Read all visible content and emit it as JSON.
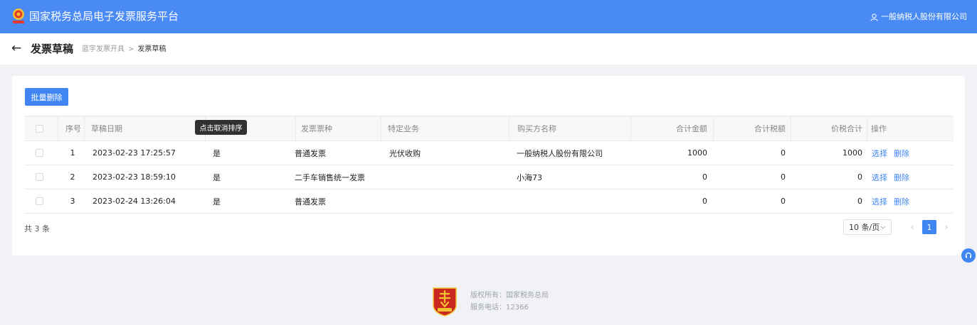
{
  "header": {
    "title": "国家税务总局电子发票服务平台",
    "user": "一般纳税人股份有限公司"
  },
  "subheader": {
    "title": "发票草稿",
    "breadcrumb_parent": "蓝字发票开具",
    "breadcrumb_sep": ">",
    "breadcrumb_current": "发票草稿"
  },
  "toolbar": {
    "batch_delete": "批量删除"
  },
  "table": {
    "columns": {
      "index": "序号",
      "draft_date": "草稿日期",
      "invoice_type": "发票票种",
      "special_business": "特定业务",
      "buyer_name": "购买方名称",
      "total_amount": "合计金额",
      "total_tax": "合计税额",
      "total_with_tax": "价税合计",
      "actions": "操作"
    },
    "rows": [
      {
        "index": "1",
        "draft_date": "2023-02-23 17:25:57",
        "flag": "是",
        "invoice_type": "普通发票",
        "special_business": "光伏收购",
        "buyer_name": "一般纳税人股份有限公司",
        "total_amount": "1000",
        "total_tax": "0",
        "total_with_tax": "1000",
        "select": "选择",
        "delete": "删除"
      },
      {
        "index": "2",
        "draft_date": "2023-02-23 18:59:10",
        "flag": "是",
        "invoice_type": "二手车销售统一发票",
        "special_business": "",
        "buyer_name": "小海73",
        "total_amount": "0",
        "total_tax": "0",
        "total_with_tax": "0",
        "select": "选择",
        "delete": "删除"
      },
      {
        "index": "3",
        "draft_date": "2023-02-24 13:26:04",
        "flag": "是",
        "invoice_type": "普通发票",
        "special_business": "",
        "buyer_name": "",
        "total_amount": "0",
        "total_tax": "0",
        "total_with_tax": "0",
        "select": "选择",
        "delete": "删除"
      }
    ],
    "tooltip": "点击取消排序"
  },
  "pagination": {
    "total": "共 3 条",
    "page_size": "10 条/页",
    "prev": "‹",
    "next": "›",
    "current_page": "1"
  },
  "footer": {
    "copyright": "版权所有：国家税务总局",
    "phone": "服务电话：12366"
  },
  "colors": {
    "primary": "#3f86f3",
    "header_bg": "#4a8af4",
    "page_bg": "#f0f2f5",
    "badge_red": "#c8281e",
    "badge_gold": "#f2c230"
  },
  "icons": {
    "header_logo": "tax-emblem-icon",
    "user": "user-icon",
    "back": "arrow-left-icon",
    "sort": "sort-caret-icon",
    "select": "chevron-down-icon",
    "float": "headset-icon",
    "footer_logo": "tax-shield-icon"
  }
}
